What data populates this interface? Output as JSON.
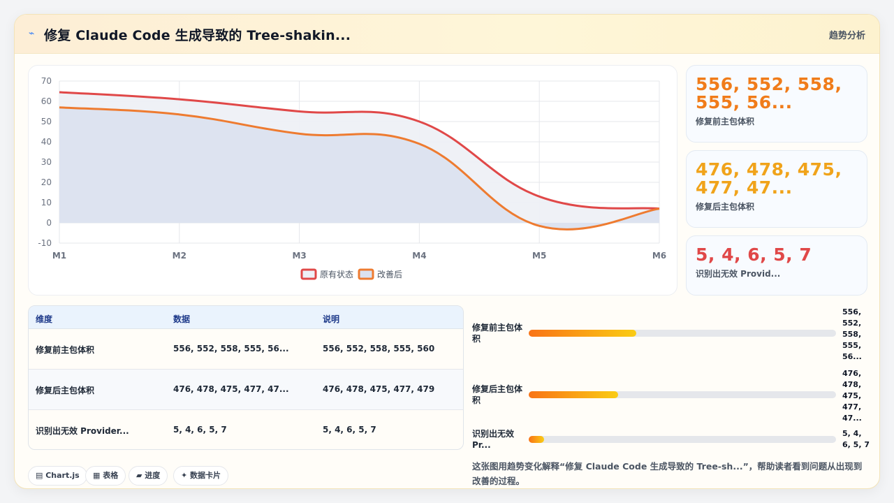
{
  "header": {
    "title": "修复 Claude Code 生成导致的 Tree-shakin...",
    "tag": "趋势分析",
    "icon": "lightning-icon"
  },
  "chart_data": {
    "type": "line",
    "categories": [
      "M1",
      "M2",
      "M3",
      "M4",
      "M5",
      "M6"
    ],
    "ylim": [
      -10,
      70
    ],
    "yticks": [
      -10,
      0,
      10,
      20,
      30,
      40,
      50,
      60,
      70
    ],
    "grid": true,
    "legend": "bottom",
    "series": [
      {
        "name": "原有状态",
        "values": [
          64.5,
          61,
          55,
          50,
          13,
          7
        ],
        "color": "#e04848",
        "fill": "#eef0f6"
      },
      {
        "name": "改善后",
        "values": [
          57,
          53.5,
          44,
          39,
          -1.5,
          7
        ],
        "color": "#ee7b30",
        "fill": "#dbe2ef"
      }
    ]
  },
  "stats": [
    {
      "value": "556, 552, 558, 555, 56...",
      "label": "修复前主包体积",
      "color": "#f07c1a"
    },
    {
      "value": "476, 478, 475, 477, 47...",
      "label": "修复后主包体积",
      "color": "#f0a31a"
    },
    {
      "value": "5, 4, 6, 5, 7",
      "label": "识别出无效 Provid...",
      "color": "#e04848"
    }
  ],
  "table": {
    "headers": [
      "维度",
      "数据",
      "说明"
    ],
    "rows": [
      [
        "修复前主包体积",
        "556, 552, 558, 555, 56...",
        "556, 552, 558, 555, 560"
      ],
      [
        "修复后主包体积",
        "476, 478, 475, 477, 47...",
        "476, 478, 475, 477, 479"
      ],
      [
        "识别出无效 Provider...",
        "5, 4, 6, 5, 7",
        "5, 4, 6, 5, 7"
      ]
    ]
  },
  "progress": [
    {
      "label": "修复前主包体积",
      "value": "556, 552, 558, 555, 56...",
      "fraction": 0.35
    },
    {
      "label": "修复后主包体积",
      "value": "476, 478, 475, 477, 47...",
      "fraction": 0.29
    },
    {
      "label": "识别出无效 Pr...",
      "value": "5, 4, 6, 5, 7",
      "fraction": 0.05
    }
  ],
  "chips": [
    "▤ Chart.js",
    "▦ 表格",
    "▰ 进度",
    "✦ 数据卡片"
  ],
  "description": "这张图用趋势变化解释“修复 Claude Code 生成导致的 Tree-sh...”，帮助读者看到问题从出现到改善的过程。"
}
